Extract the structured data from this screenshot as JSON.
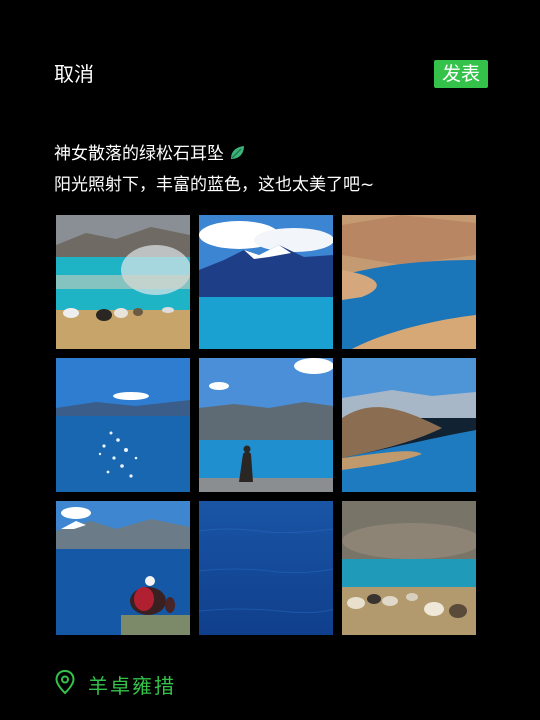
{
  "header": {
    "cancel_label": "取消",
    "publish_label": "发表"
  },
  "post": {
    "line1": "神女散落的绿松石耳坠",
    "line2": "阳光照射下，丰富的蓝色，这也太美了吧~",
    "line1_icon": "leaf-emoji-icon"
  },
  "photos": [
    {
      "name": "photo-lake-dust-yaks"
    },
    {
      "name": "photo-snow-mountain-lake"
    },
    {
      "name": "photo-desert-hills-lake"
    },
    {
      "name": "photo-sparkling-water"
    },
    {
      "name": "photo-person-by-lake"
    },
    {
      "name": "photo-winding-lakeshore"
    },
    {
      "name": "photo-tibetan-person-blue-lake"
    },
    {
      "name": "photo-deep-blue-water"
    },
    {
      "name": "photo-sheep-by-lake"
    }
  ],
  "location": {
    "icon": "location-pin-icon",
    "label": "羊卓雍措"
  },
  "colors": {
    "accent": "#35c24a",
    "background": "#000000",
    "text": "#ffffff"
  }
}
